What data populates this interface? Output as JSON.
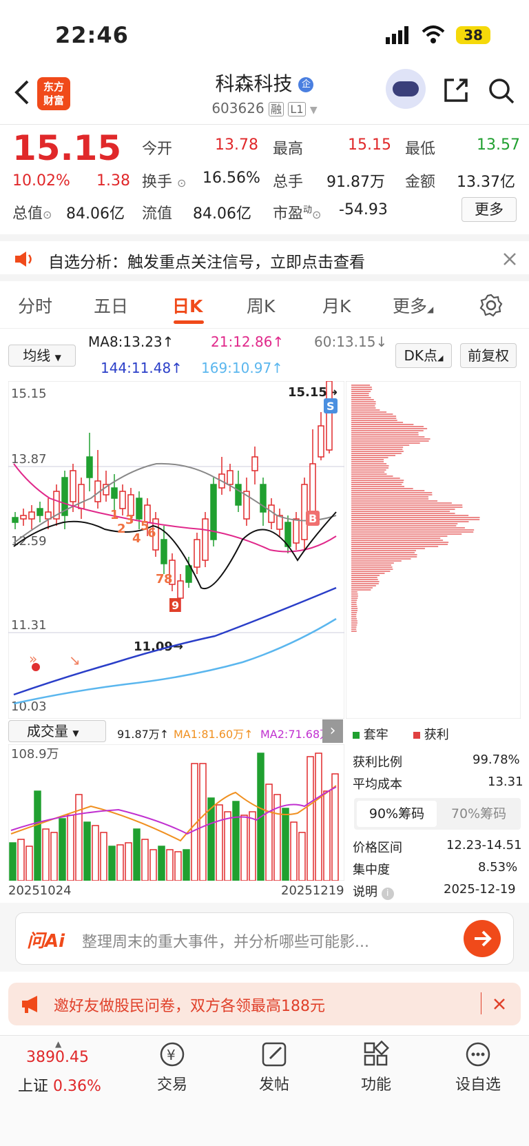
{
  "status": {
    "time": "22:46",
    "battery": "38"
  },
  "header": {
    "name": "科森科技",
    "code": "603626",
    "tag_rong": "融",
    "tag_level": "L1",
    "logo_text": "东方财富"
  },
  "quote": {
    "price": "15.15",
    "pct": "10.02%",
    "chg": "1.38",
    "open_label": "今开",
    "open": "13.78",
    "high_label": "最高",
    "high": "15.15",
    "low_label": "最低",
    "low": "13.57",
    "turnover_label": "换手",
    "turnover": "16.56%",
    "volume_label": "总手",
    "volume": "91.87万",
    "amount_label": "金额",
    "amount": "13.37亿",
    "mktcap_label": "总值",
    "mktcap": "84.06亿",
    "float_label": "流值",
    "float": "84.06亿",
    "pe_label": "市盈",
    "pe_sup": "动",
    "pe": "-54.93",
    "more": "更多"
  },
  "alert": {
    "text": "自选分析：触发重点关注信号，立即点击查看"
  },
  "tabs": [
    "分时",
    "五日",
    "日K",
    "周K",
    "月K",
    "更多"
  ],
  "active_tab": "日K",
  "ma": {
    "selector": "均线",
    "ma8": "MA8:13.23↑",
    "ma21": "21:12.86↑",
    "ma60": "60:13.15↓",
    "ma144": "144:11.48↑",
    "ma169": "169:10.97↑",
    "dk_btn": "DK点",
    "fq_btn": "前复权"
  },
  "chart_data": {
    "type": "candlestick",
    "y_ticks": [
      "15.15",
      "13.87",
      "11.31",
      "10.03"
    ],
    "price_annotations": {
      "high": "15.15→",
      "low": "11.09→",
      "mid_left": "12.59"
    },
    "signals": [
      "1",
      "2",
      "3",
      "4",
      "5",
      "6",
      "7",
      "8",
      "9"
    ],
    "badges": {
      "sell": "S",
      "buy": "B"
    }
  },
  "volume": {
    "selector": "成交量",
    "vol": "91.87万↑",
    "ma1": "MA1:81.60万↑",
    "ma2": "MA2:71.68万",
    "max": "108.9万",
    "date_start": "20251024",
    "date_end": "20251219"
  },
  "chips": {
    "legend_trap": "套牢",
    "legend_profit": "获利",
    "profit_ratio_label": "获利比例",
    "profit_ratio": "99.78%",
    "avg_cost_label": "平均成本",
    "avg_cost": "13.31",
    "tab90": "90%筹码",
    "tab70": "70%筹码",
    "range_label": "价格区间",
    "range": "12.23-14.51",
    "conc_label": "集中度",
    "conc": "8.53%",
    "note_label": "说明",
    "date": "2025-12-19"
  },
  "ask": {
    "brand": "问Ai",
    "placeholder": "整理周末的重大事件，并分析哪些可能影..."
  },
  "promo": {
    "text": "邀好友做股民问卷，双方各领最高188元"
  },
  "bottom": {
    "index_value": "3890.45",
    "index_name": "上证",
    "index_pct": "0.36%",
    "trade": "交易",
    "post": "发帖",
    "func": "功能",
    "watch": "设自选"
  },
  "colors": {
    "up": "#e0282a",
    "down": "#20a030",
    "accent": "#f04a1a"
  }
}
